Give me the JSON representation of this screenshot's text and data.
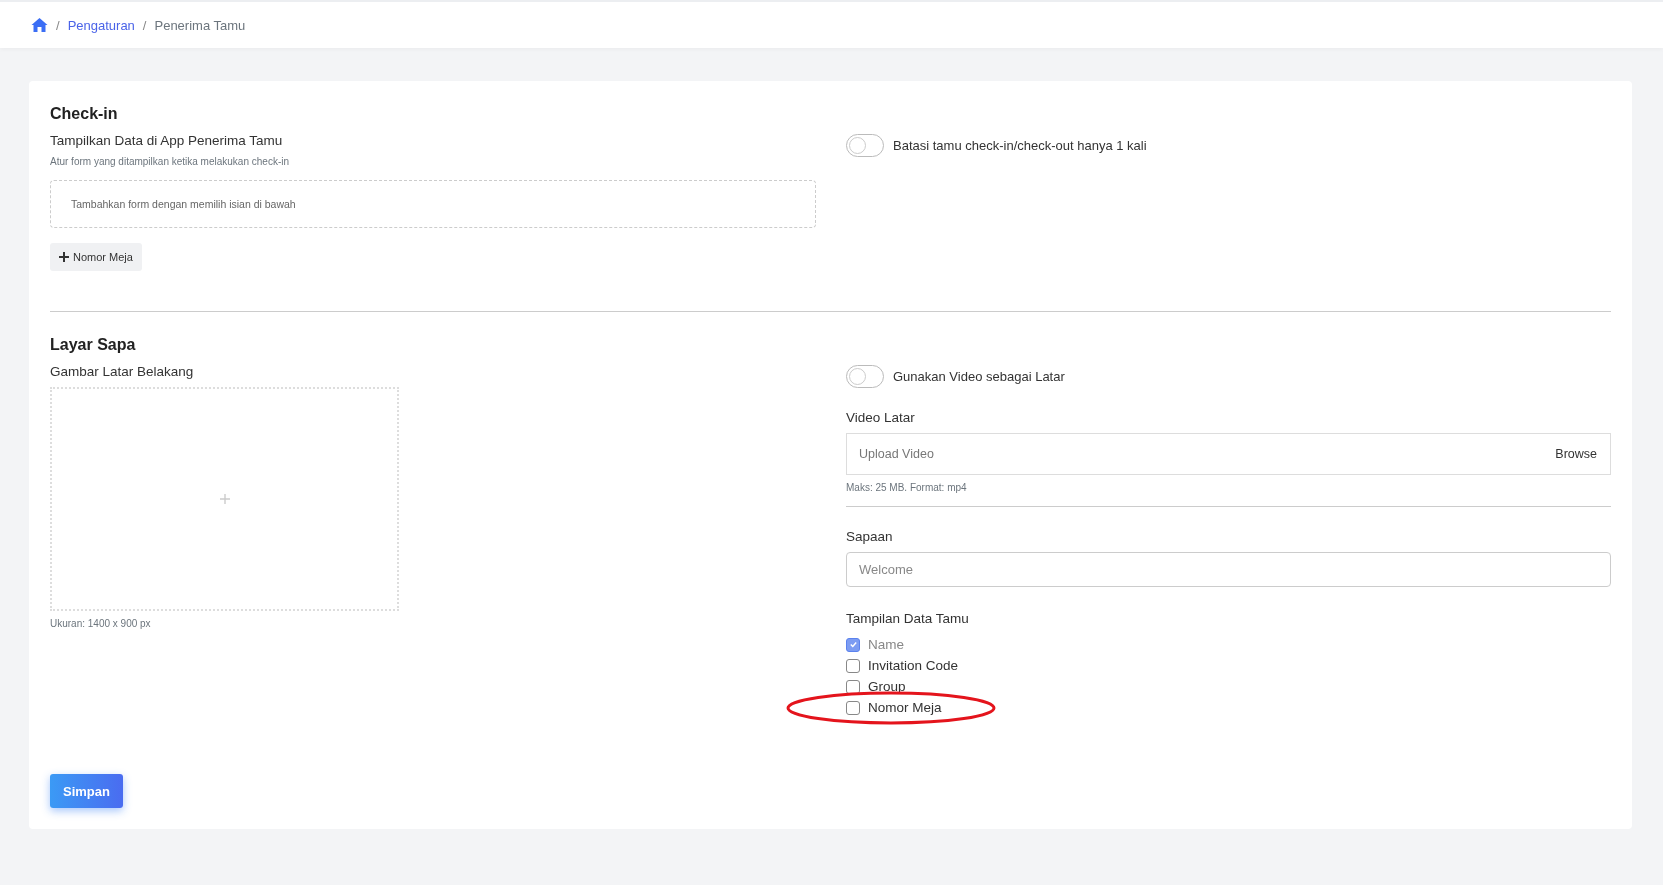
{
  "breadcrumb": [
    {
      "separator": "/",
      "label": "Pengaturan",
      "kind": "link"
    },
    {
      "separator": "/",
      "label": "Penerima Tamu",
      "kind": "current"
    }
  ],
  "checkin": {
    "title": "Check-in",
    "field_label": "Tampilkan Data di App Penerima Tamu",
    "hint": "Atur form yang ditampilkan ketika melakukan check-in",
    "dropzone_text": "Tambahkan form dengan memilih isian di bawah",
    "add_buttons": [
      "Nomor Meja"
    ],
    "toggle": {
      "label": "Batasi tamu check-in/check-out hanya 1 kali",
      "on": false
    }
  },
  "layar_sapa": {
    "title": "Layar Sapa",
    "image_label": "Gambar Latar Belakang",
    "image_hint": "Ukuran: 1400 x 900 px",
    "video_toggle": {
      "label": "Gunakan Video sebagai Latar",
      "on": false
    },
    "video_label": "Video Latar",
    "video_placeholder": "Upload Video",
    "browse_label": "Browse",
    "video_hint": "Maks: 25 MB. Format: mp4",
    "greeting_label": "Sapaan",
    "greeting_placeholder": "Welcome",
    "guest_data_label": "Tampilan Data Tamu",
    "guest_fields": [
      {
        "label": "Name",
        "checked": true,
        "disabled": true,
        "highlighted": false
      },
      {
        "label": "Invitation Code",
        "checked": false,
        "disabled": false,
        "highlighted": false
      },
      {
        "label": "Group",
        "checked": false,
        "disabled": false,
        "highlighted": false
      },
      {
        "label": "Nomor Meja",
        "checked": false,
        "disabled": false,
        "highlighted": true
      }
    ]
  },
  "save_button": "Simpan"
}
